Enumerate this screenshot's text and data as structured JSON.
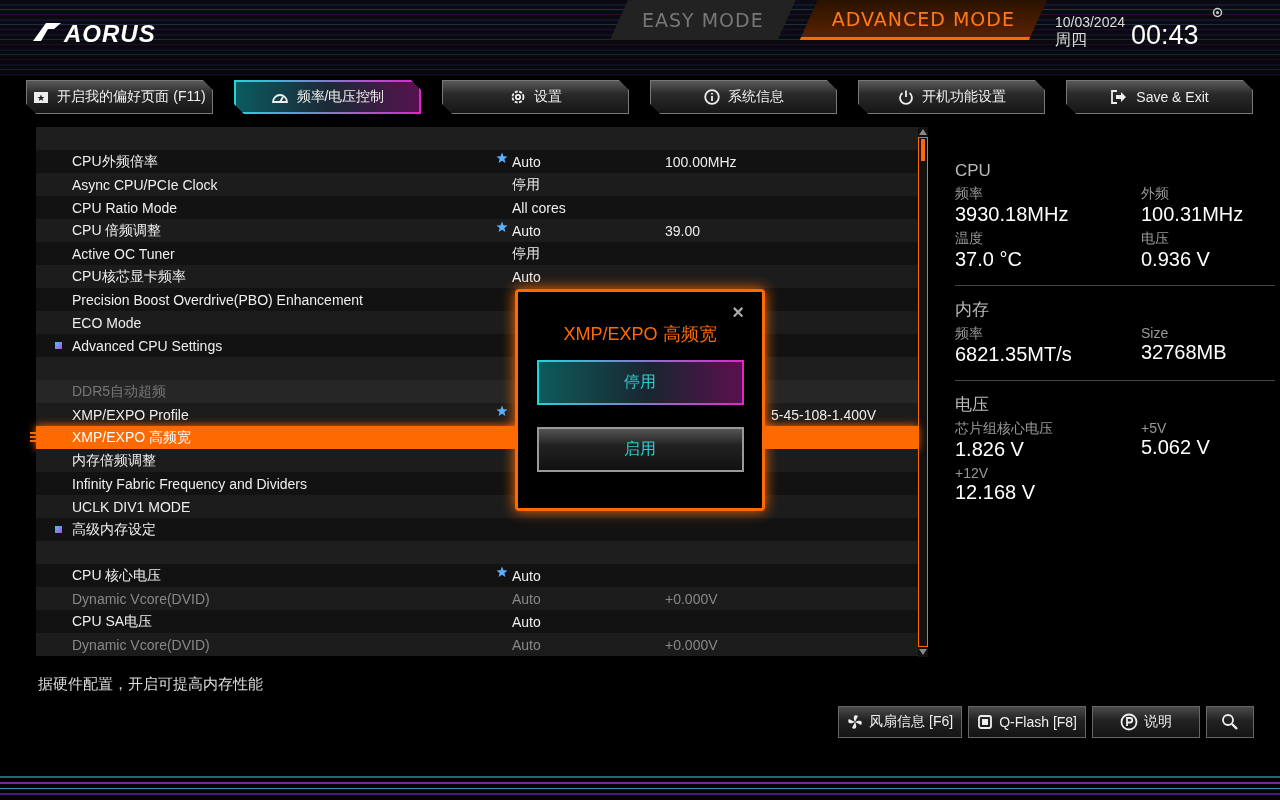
{
  "header": {
    "logo": "AORUS",
    "modes": [
      {
        "label": "EASY MODE",
        "selected": false
      },
      {
        "label": "ADVANCED MODE",
        "selected": true
      }
    ],
    "date": "10/03/2024",
    "weekday": "周四",
    "time": "00:43"
  },
  "tabs": [
    {
      "label": "开启我的偏好页面 (F11)",
      "selected": false
    },
    {
      "label": "频率/电压控制",
      "selected": true
    },
    {
      "label": "设置",
      "selected": false
    },
    {
      "label": "系统信息",
      "selected": false
    },
    {
      "label": "开机功能设置",
      "selected": false
    },
    {
      "label": "Save & Exit",
      "selected": false
    }
  ],
  "settings": [
    {
      "kind": "blank"
    },
    {
      "kind": "setting",
      "label": "CPU外频倍率",
      "starred": true,
      "value": "Auto",
      "value2": "100.00MHz",
      "disabled": false,
      "selected": false
    },
    {
      "kind": "setting",
      "label": "Async CPU/PCIe Clock",
      "starred": false,
      "value": "停用",
      "disabled": false,
      "selected": false
    },
    {
      "kind": "setting",
      "label": "CPU Ratio Mode",
      "starred": false,
      "value": "All cores",
      "disabled": false,
      "selected": false
    },
    {
      "kind": "setting",
      "label": "CPU 倍频调整",
      "starred": true,
      "value": "Auto",
      "value2": "39.00",
      "disabled": false,
      "selected": false
    },
    {
      "kind": "setting",
      "label": "Active OC Tuner",
      "starred": false,
      "value": "停用",
      "disabled": false,
      "selected": false
    },
    {
      "kind": "setting",
      "label": "CPU核芯显卡频率",
      "starred": false,
      "value": "Auto",
      "disabled": false,
      "selected": false
    },
    {
      "kind": "setting",
      "label": "Precision Boost Overdrive(PBO) Enhancement",
      "starred": false,
      "disabled": false,
      "selected": false
    },
    {
      "kind": "setting",
      "label": "ECO Mode",
      "starred": false,
      "disabled": false,
      "selected": false
    },
    {
      "kind": "submenu",
      "label": "Advanced CPU Settings"
    },
    {
      "kind": "blank"
    },
    {
      "kind": "header",
      "label": "DDR5自动超频"
    },
    {
      "kind": "setting",
      "label": "XMP/EXPO Profile",
      "starred": true,
      "value2": "5-45-108-1.400V",
      "disabled": false,
      "selected": false
    },
    {
      "kind": "setting",
      "label": "XMP/EXPO 高频宽",
      "starred": false,
      "disabled": false,
      "selected": true
    },
    {
      "kind": "setting",
      "label": "内存倍频调整",
      "starred": false,
      "disabled": false,
      "selected": false
    },
    {
      "kind": "setting",
      "label": "Infinity Fabric Frequency and Dividers",
      "starred": false,
      "disabled": false,
      "selected": false
    },
    {
      "kind": "setting",
      "label": "UCLK DIV1 MODE",
      "starred": false,
      "disabled": false,
      "selected": false
    },
    {
      "kind": "submenu",
      "label": "高级内存设定"
    },
    {
      "kind": "blank"
    },
    {
      "kind": "setting",
      "label": "CPU 核心电压",
      "starred": true,
      "value": "Auto",
      "disabled": false,
      "selected": false
    },
    {
      "kind": "setting",
      "label": "Dynamic Vcore(DVID)",
      "starred": false,
      "value": "Auto",
      "value2": "+0.000V",
      "disabled": true,
      "selected": false
    },
    {
      "kind": "setting",
      "label": "CPU SA电压",
      "starred": false,
      "value": "Auto",
      "disabled": false,
      "selected": false
    },
    {
      "kind": "setting",
      "label": "Dynamic Vcore(DVID)",
      "starred": false,
      "value": "Auto",
      "value2": "+0.000V",
      "disabled": true,
      "selected": false
    }
  ],
  "dialog": {
    "title": "XMP/EXPO 高频宽",
    "close": "×",
    "options": [
      {
        "label": "停用",
        "selected": true
      },
      {
        "label": "启用",
        "selected": false
      }
    ]
  },
  "monitor": [
    {
      "title": "CPU",
      "items": [
        {
          "label": "频率",
          "value": "3930.18MHz"
        },
        {
          "label": "外频",
          "value": "100.31MHz"
        },
        {
          "label": "温度",
          "value": "37.0 °C"
        },
        {
          "label": "电压",
          "value": "0.936 V"
        }
      ]
    },
    {
      "title": "内存",
      "items": [
        {
          "label": "频率",
          "value": "6821.35MT/s"
        },
        {
          "label": "Size",
          "value": "32768MB"
        }
      ]
    },
    {
      "title": "电压",
      "items": [
        {
          "label": "芯片组核心电压",
          "value": "1.826 V"
        },
        {
          "label": "+5V",
          "value": "5.062 V"
        },
        {
          "label": "+12V",
          "value": "12.168 V"
        }
      ]
    }
  ],
  "help_text": "据硬件配置，开启可提高内存性能",
  "bottom_buttons": [
    {
      "label": "风扇信息 [F6]"
    },
    {
      "label": "Q-Flash [F8]"
    },
    {
      "label": "说明"
    }
  ]
}
